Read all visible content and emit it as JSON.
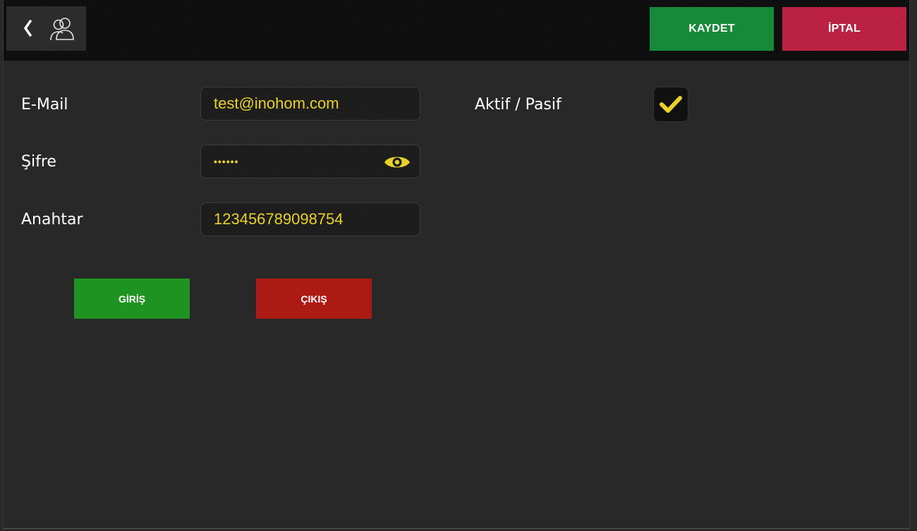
{
  "header": {
    "back_icon": "chevron-left-icon",
    "users_icon": "users-icon",
    "save_label": "KAYDET",
    "cancel_label": "İPTAL"
  },
  "form": {
    "email": {
      "label": "E-Mail",
      "value": "test@inohom.com"
    },
    "password": {
      "label": "Şifre",
      "masked_value": "••••••",
      "toggle_icon": "eye-icon"
    },
    "key": {
      "label": "Anahtar",
      "value": "123456789098754"
    },
    "active": {
      "label": "Aktif / Pasif",
      "checked": true,
      "icon": "checkmark-icon"
    }
  },
  "actions": {
    "login_label": "GİRİŞ",
    "logout_label": "ÇIKIŞ"
  },
  "colors": {
    "accent_yellow": "#e8d22a",
    "save_green": "#178a3a",
    "cancel_red": "#b81d3f",
    "login_green": "#1f9321",
    "logout_red": "#ad1a14",
    "background": "#282828",
    "topbar": "#0c0c0c"
  }
}
